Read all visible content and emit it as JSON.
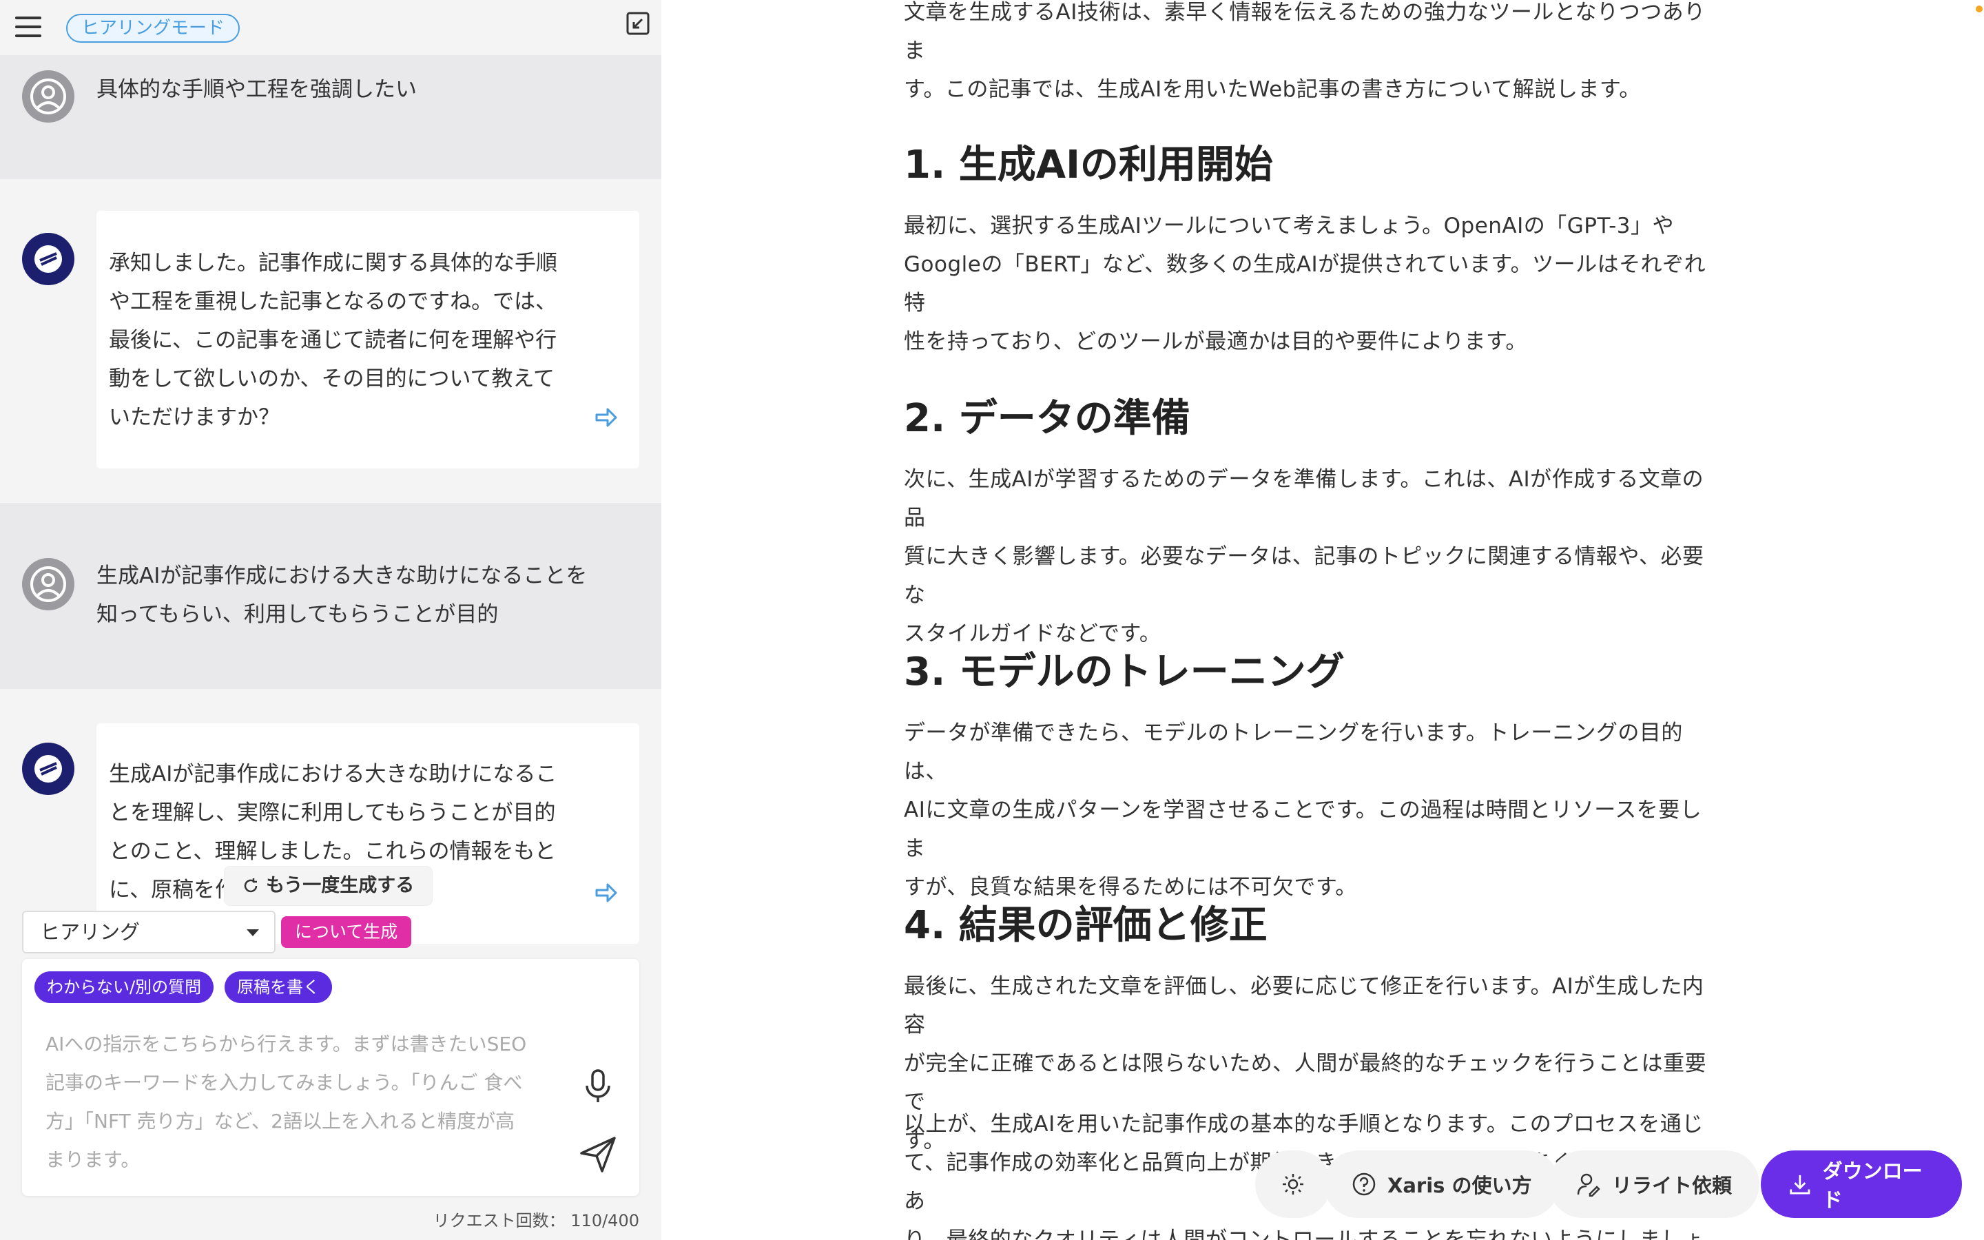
{
  "header": {
    "mode_badge": "ヒアリングモード"
  },
  "chat": {
    "user_msg_1": "具体的な手順や工程を強調したい",
    "ai_msg_1_lines": [
      "承知しました。記事作成に関する具体的な手順",
      "や工程を重視した記事となるのですね。では、",
      "最後に、この記事を通じて読者に何を理解や行",
      "動をして欲しいのか、その目的について教えて",
      "いただけますか？"
    ],
    "user_msg_2_lines": [
      "生成AIが記事作成における大きな助けになることを",
      "知ってもらい、利用してもらうことが目的"
    ],
    "ai_msg_2_lines": [
      "生成AIが記事作成における大きな助けになるこ",
      "とを理解し、実際に利用してもらうことが目的",
      "とのこと、理解しました。これらの情報をもと",
      "に、原稿を作"
    ],
    "regenerate_label": "もう一度生成する"
  },
  "composer": {
    "select_value": "ヒアリング",
    "generate_chip": "について生成",
    "chip_unknown": "わからない/別の質問",
    "chip_write": "原稿を書く",
    "placeholder_lines": [
      "AIへの指示をこちらから行えます。まずは書きたいSEO",
      "記事のキーワードを入力してみましょう。「りんご 食べ",
      "方」「NFT 売り方」など、2語以上を入れると精度が高",
      "まります。"
    ],
    "request_count": "リクエスト回数： 110/400"
  },
  "article": {
    "intro_lines": [
      "文章を生成するAI技術は、素早く情報を伝えるための強力なツールとなりつつありま",
      "す。この記事では、生成AIを用いたWeb記事の書き方について解説します。"
    ],
    "sections": [
      {
        "heading": "1. 生成AIの利用開始",
        "lines": [
          "最初に、選択する生成AIツールについて考えましょう。OpenAIの「GPT-3」や",
          "Googleの「BERT」など、数多くの生成AIが提供されています。ツールはそれぞれ特",
          "性を持っており、どのツールが最適かは目的や要件によります。"
        ]
      },
      {
        "heading": "2. データの準備",
        "lines": [
          "次に、生成AIが学習するためのデータを準備します。これは、AIが作成する文章の品",
          "質に大きく影響します。必要なデータは、記事のトピックに関連する情報や、必要な",
          "スタイルガイドなどです。"
        ]
      },
      {
        "heading": "3. モデルのトレーニング",
        "lines": [
          "データが準備できたら、モデルのトレーニングを行います。トレーニングの目的は、",
          "AIに文章の生成パターンを学習させることです。この過程は時間とリソースを要しま",
          "すが、良質な結果を得るためには不可欠です。"
        ]
      },
      {
        "heading": "4. 結果の評価と修正",
        "lines": [
          "最後に、生成された文章を評価し、必要に応じて修正を行います。AIが生成した内容",
          "が完全に正確であるとは限らないため、人間が最終的なチェックを行うことは重要で",
          "す。"
        ]
      }
    ],
    "outro_lines": [
      "以上が、生成AIを用いた記事作成の基本的な手順となります。このプロセスを通じ",
      "て、記事作成の効率化と品質向上が期待できます。しかし、AIはあくまでツールであ",
      "り、最終的なクオリティは人間がコントロールすることを忘れないようにしましょう。"
    ]
  },
  "actions": {
    "howto_label": "Xaris の使い方",
    "rewrite_label": "リライト依頼",
    "download_label": "ダウンロード"
  },
  "colors": {
    "accent_purple": "#6a2ee8",
    "chip_purple": "#5b2be0",
    "chip_pink": "#e02fa6",
    "badge_blue": "#4a9ee0"
  }
}
